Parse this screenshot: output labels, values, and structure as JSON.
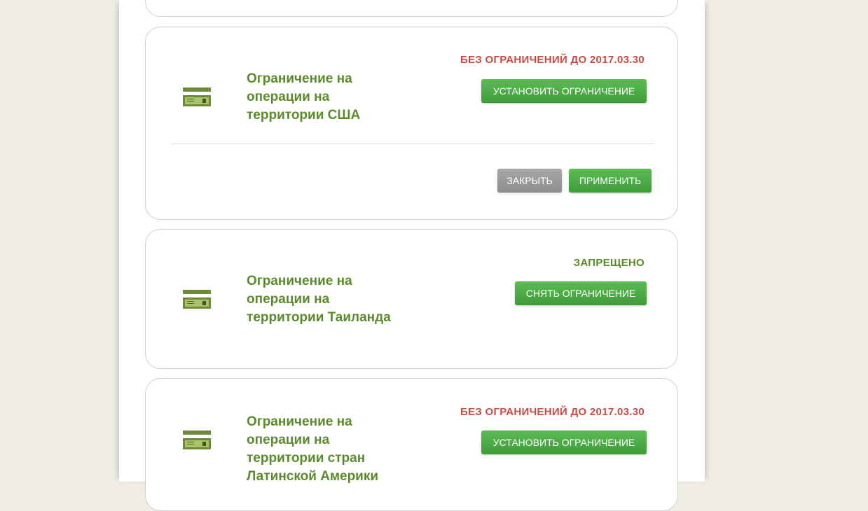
{
  "colors": {
    "background": "#f0ede6",
    "title_green": "#5a8a2a",
    "status_red": "#c94a43",
    "button_green": "#4caf45",
    "button_gray": "#9a9a9a"
  },
  "cards": [
    {
      "icon": "card-icon",
      "title": "Ограничение на\nоперации на\nтерритории США",
      "status": "БЕЗ ОГРАНИЧЕНИЙ ДО 2017.03.30",
      "action_label": "УСТАНОВИТЬ ОГРАНИЧЕНИЕ",
      "close_label": "ЗАКРЫТЬ",
      "apply_label": "ПРИМЕНИТЬ"
    },
    {
      "icon": "card-icon",
      "title": "Ограничение на\nоперации на\nтерритории Таиланда",
      "status": "ЗАПРЕЩЕНО",
      "action_label": "СНЯТЬ ОГРАНИЧЕНИЕ"
    },
    {
      "icon": "card-icon",
      "title": "Ограничение на\nоперации на\nтерритории стран\nЛатинской Америки",
      "status": "БЕЗ ОГРАНИЧЕНИЙ ДО 2017.03.30",
      "action_label": "УСТАНОВИТЬ ОГРАНИЧЕНИЕ"
    }
  ]
}
